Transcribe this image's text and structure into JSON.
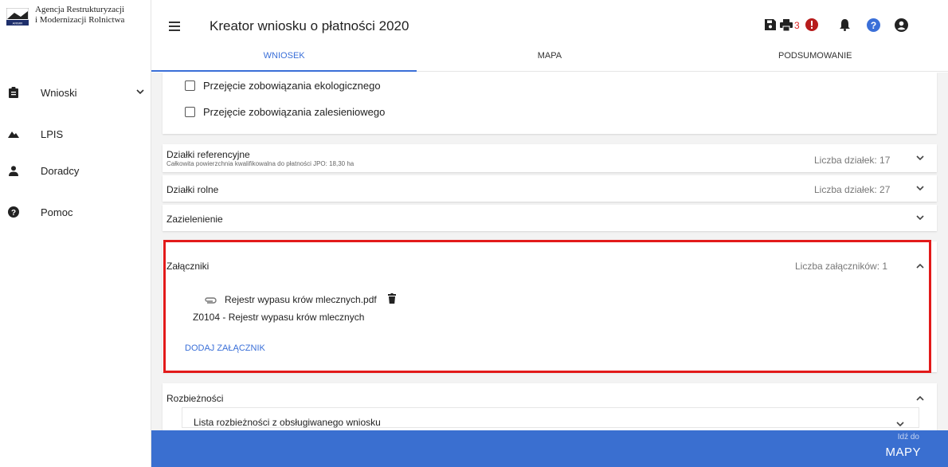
{
  "org": {
    "name_line1": "Agencja Restrukturyzacji",
    "name_line2": "i Modernizacji Rolnictwa",
    "logo_text": "ARiMR"
  },
  "sidebar": {
    "items": [
      {
        "label": "Wnioski",
        "icon": "clipboard-icon",
        "has_chevron": true
      },
      {
        "label": "LPIS",
        "icon": "mountain-icon"
      },
      {
        "label": "Doradcy",
        "icon": "person-icon"
      },
      {
        "label": "Pomoc",
        "icon": "help-icon"
      }
    ]
  },
  "header": {
    "title": "Kreator wniosku o płatności 2020",
    "error_count": "3",
    "icons": [
      "save-icon",
      "print-icon",
      "error-icon",
      "bell-icon",
      "help-icon",
      "account-icon"
    ]
  },
  "tabs": [
    {
      "label": "WNIOSEK",
      "active": true
    },
    {
      "label": "MAPA",
      "active": false
    },
    {
      "label": "PODSUMOWANIE",
      "active": false
    }
  ],
  "checkboxes": [
    {
      "label": "Przejęcie zobowiązania ekologicznego",
      "checked": false
    },
    {
      "label": "Przejęcie zobowiązania zalesieniowego",
      "checked": false
    }
  ],
  "panels": {
    "dzialki_ref": {
      "title": "Działki referencyjne",
      "subtitle": "Całkowita powierzchnia kwalifikowalna do płatności JPO: 18,30 ha",
      "count": "Liczba działek: 17"
    },
    "dzialki_rolne": {
      "title": "Działki rolne",
      "count": "Liczba działek: 27"
    },
    "zazielenienie": {
      "title": "Zazielenienie"
    },
    "zalaczniki": {
      "title": "Załączniki",
      "count": "Liczba załączników: 1",
      "file_name": "Rejestr wypasu krów mlecznych.pdf",
      "file_type": "Z0104 - Rejestr wypasu krów mlecznych",
      "add_label": "DODAJ ZAŁĄCZNIK"
    },
    "rozbieznosci": {
      "title": "Rozbieżności",
      "sub_item": "Lista rozbieżności z obsługiwanego wniosku"
    }
  },
  "bottom": {
    "small": "Idź do",
    "big": "MAPY"
  },
  "colors": {
    "accent": "#3a6fd8",
    "highlight": "#e21a1a",
    "bottom_bar": "#3a6fd0",
    "error": "#b71c1c"
  }
}
